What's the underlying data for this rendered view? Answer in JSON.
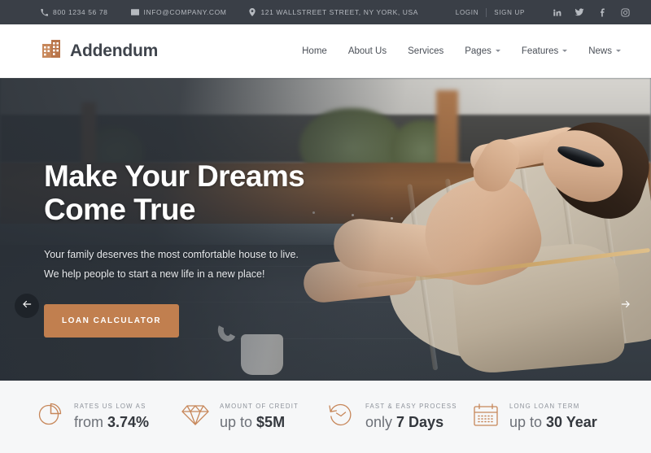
{
  "topbar": {
    "phone": "800 1234 56 78",
    "email": "INFO@COMPANY.COM",
    "address": "121 WALLSTREET STREET, NY YORK, USA",
    "login": "LOGIN",
    "signup": "SIGN UP",
    "social": [
      {
        "name": "linkedin-icon",
        "glyph": "in"
      },
      {
        "name": "twitter-icon",
        "glyph": "t"
      },
      {
        "name": "facebook-icon",
        "glyph": "f"
      },
      {
        "name": "instagram-icon",
        "glyph": "ig"
      }
    ],
    "bg_color": "#3a3f47"
  },
  "header": {
    "brand": "Addendum",
    "logo_icon": "building-icon",
    "accent_color": "#c7875a",
    "nav": [
      {
        "label": "Home",
        "dropdown": false
      },
      {
        "label": "About Us",
        "dropdown": false
      },
      {
        "label": "Services",
        "dropdown": false
      },
      {
        "label": "Pages",
        "dropdown": true
      },
      {
        "label": "Features",
        "dropdown": true
      },
      {
        "label": "News",
        "dropdown": true
      }
    ]
  },
  "hero": {
    "title_line1": "Make Your Dreams",
    "title_line2": "Come True",
    "sub_line1": "Your family deserves the most comfortable house to live.",
    "sub_line2": "We help people to start a new life in a new place!",
    "cta": "LOAN CALCULATOR",
    "cta_color": "#c17f4f",
    "prev_label": "←",
    "next_label": "→"
  },
  "features": [
    {
      "icon": "pie-chart-icon",
      "label": "RATES US LOW AS",
      "prefix": "from ",
      "value": "3.74%"
    },
    {
      "icon": "diamond-icon",
      "label": "AMOUNT OF CREDIT",
      "prefix": "up to ",
      "value": "$5M"
    },
    {
      "icon": "clock-rewind-icon",
      "label": "FAST & EASY PROCESS",
      "prefix": "only ",
      "value": "7 Days"
    },
    {
      "icon": "calendar-icon",
      "label": "LONG LOAN TERM",
      "prefix": "up to ",
      "value": "30 Year"
    }
  ]
}
